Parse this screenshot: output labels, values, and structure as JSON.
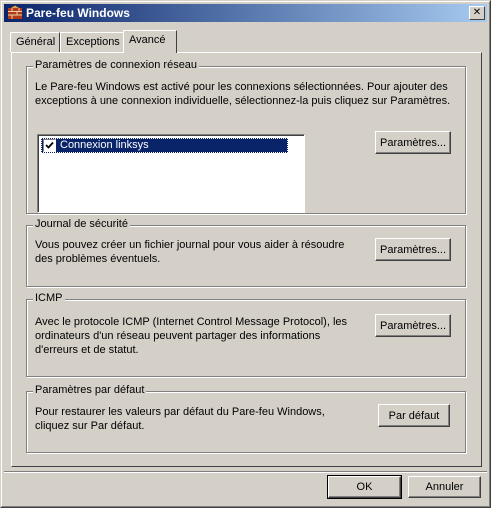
{
  "window": {
    "title": "Pare-feu Windows",
    "close_glyph": "✕"
  },
  "tabs": [
    {
      "label": "Général",
      "active": false
    },
    {
      "label": "Exceptions",
      "active": false
    },
    {
      "label": "Avancé",
      "active": true
    }
  ],
  "network": {
    "title": "Paramètres de connexion réseau",
    "description_line1": "Le Pare-feu Windows est activé pour les connexions sélectionnées. Pour ajouter des",
    "description_line2": "exceptions à une connexion individuelle, sélectionnez-la puis cliquez sur Paramètres.",
    "connections": [
      {
        "label": "Connexion linksys",
        "checked": true,
        "selected": true
      }
    ],
    "settings_button": "Paramètres..."
  },
  "security_log": {
    "title": "Journal de sécurité",
    "description_line1": "Vous pouvez créer un fichier journal pour vous aider à résoudre",
    "description_line2": "des problèmes éventuels.",
    "settings_button": "Paramètres..."
  },
  "icmp": {
    "title": "ICMP",
    "description_line1": "Avec le protocole ICMP (Internet Control Message Protocol), les",
    "description_line2": "ordinateurs d'un réseau peuvent partager des informations",
    "description_line3": "d'erreurs et de statut.",
    "settings_button": "Paramètres..."
  },
  "defaults": {
    "title": "Paramètres par défaut",
    "description_line1": "Pour restaurer les valeurs par défaut du Pare-feu Windows,",
    "description_line2": "cliquez sur Par défaut.",
    "default_button": "Par défaut"
  },
  "footer": {
    "ok_button": "OK",
    "cancel_button": "Annuler"
  },
  "colors": {
    "titlebar_start": "#0a246a",
    "titlebar_end": "#a6caf0",
    "face": "#d4d0c8",
    "selection": "#0a246a"
  },
  "icons": {
    "app": "firewall-brick-icon",
    "check": "checkmark-icon"
  }
}
